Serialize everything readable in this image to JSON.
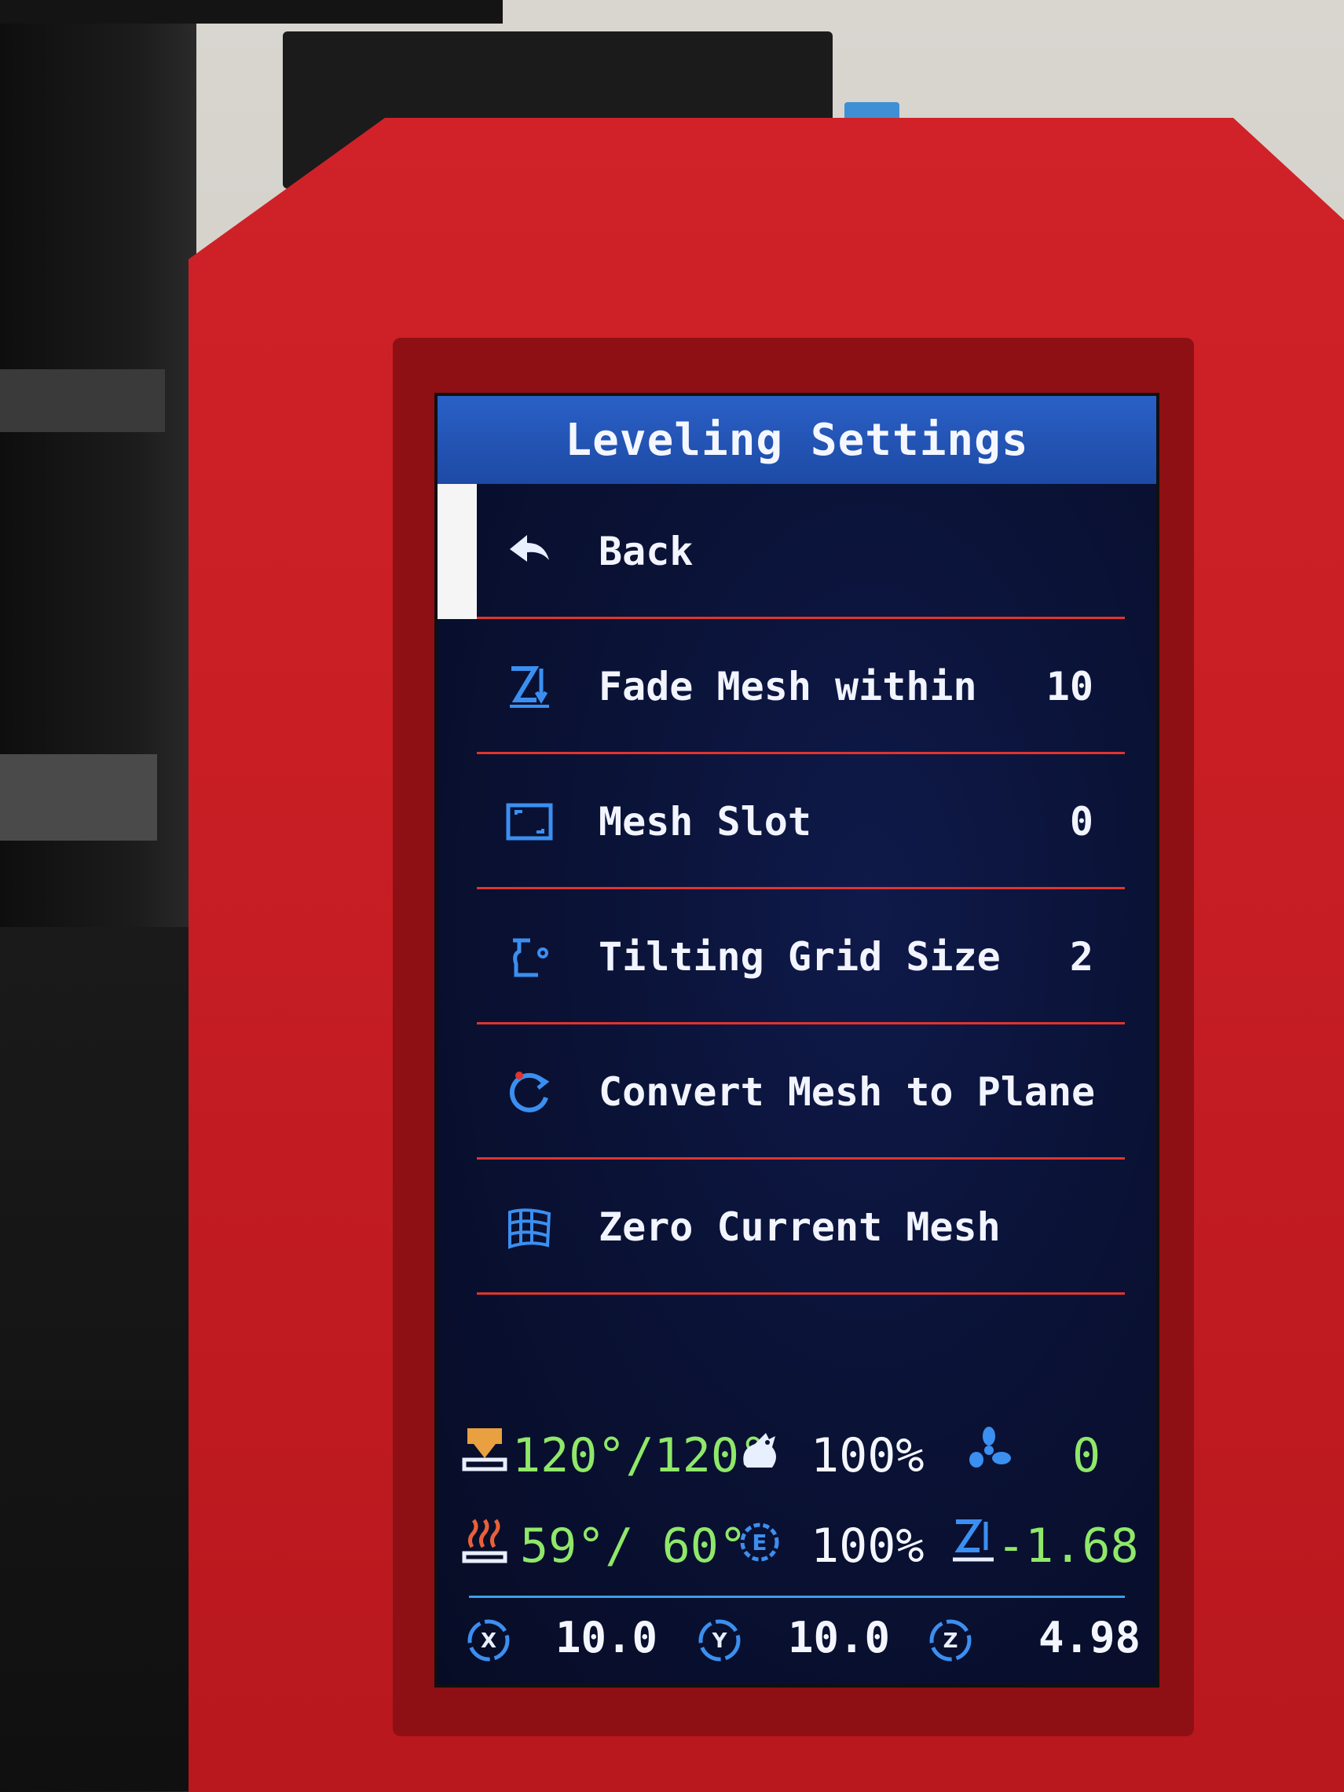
{
  "screen": {
    "title": "Leveling Settings"
  },
  "menu": {
    "items": [
      {
        "label": "Back",
        "value": "",
        "icon": "back-arrow-icon"
      },
      {
        "label": "Fade Mesh within",
        "value": "10",
        "icon": "z-fade-icon"
      },
      {
        "label": "Mesh Slot",
        "value": "0",
        "icon": "mesh-slot-icon"
      },
      {
        "label": "Tilting Grid Size",
        "value": "2",
        "icon": "tilting-grid-icon"
      },
      {
        "label": "Convert Mesh to Plane",
        "value": "",
        "icon": "convert-cycle-icon"
      },
      {
        "label": "Zero Current Mesh",
        "value": "",
        "icon": "mesh-grid-icon"
      }
    ]
  },
  "status": {
    "hotend": "120°/120°",
    "feedrate": "100%",
    "fan": "0",
    "bed": "59°/ 60°",
    "flow": "100%",
    "z_offset": "-1.68"
  },
  "axes": {
    "x": "10.0",
    "y": "10.0",
    "z": "4.98"
  },
  "colors": {
    "title_bar": "#2a60c6",
    "screen_bg": "#0a1236",
    "separator": "#e0342f",
    "status_value": "#8fe86a",
    "icon": "#3b8ff0",
    "case": "#c51d23"
  }
}
